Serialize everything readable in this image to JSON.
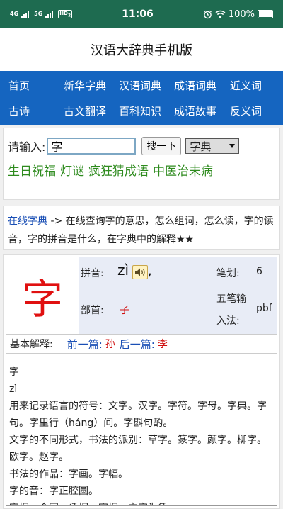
{
  "status_bar": {
    "net1": "4G",
    "net2": "5G",
    "hd": "HD",
    "hd_sub": "2",
    "time": "11:06",
    "alarm_icon": "alarm-icon",
    "wifi_icon": "wifi-icon",
    "battery": "100%"
  },
  "header": {
    "title": "汉语大辞典手机版"
  },
  "nav": {
    "row1": [
      "首页",
      "新华字典",
      "汉语词典",
      "成语词典",
      "近义词"
    ],
    "row2": [
      "古诗",
      "古文翻译",
      "百科知识",
      "成语故事",
      "反义词"
    ]
  },
  "search": {
    "label": "请输入:",
    "value": "字",
    "button": "搜一下",
    "select_value": "字典",
    "quick_links": [
      "生日祝福",
      "灯谜",
      "疯狂猜成语",
      "中医治未病"
    ]
  },
  "intro": {
    "link": "在线字典",
    "text": " -> 在线查询字的意思，怎么组词，怎么读，字的读音，字的拼音是什么，在字典中的解释★★"
  },
  "entry": {
    "char": "字",
    "pinyin_label": "拼音:",
    "pinyin": "zì",
    "pinyin_comma": ",",
    "strokes_label": "笔划:",
    "strokes": "6",
    "bushou_label": "部首:",
    "bushou": "子",
    "wubi_label_1": "五笔输",
    "wubi_label_2": "入法:",
    "wubi": "pbf",
    "basic_label": "基本解释:",
    "prev_label": "前一篇:",
    "prev_char": "孙",
    "next_label": "后一篇:",
    "next_char": "李",
    "definition": [
      "字",
      "zì",
      "用来记录语言的符号：文字。汉字。字符。字母。字典。字句。字里行（háng）间。字斟句酌。",
      "文字的不同形式，书法的派别：草字。篆字。颜字。柳字。欧字。赵字。",
      "书法的作品：字画。字幅。",
      "字的音：字正腔圆。",
      "字据，合同，凭据：字据。立字为凭。"
    ]
  },
  "colors": {
    "status_bar": "#1e6b50",
    "nav": "#1565c0",
    "green_links": "#2e8b1e",
    "char_red": "#e01010"
  }
}
